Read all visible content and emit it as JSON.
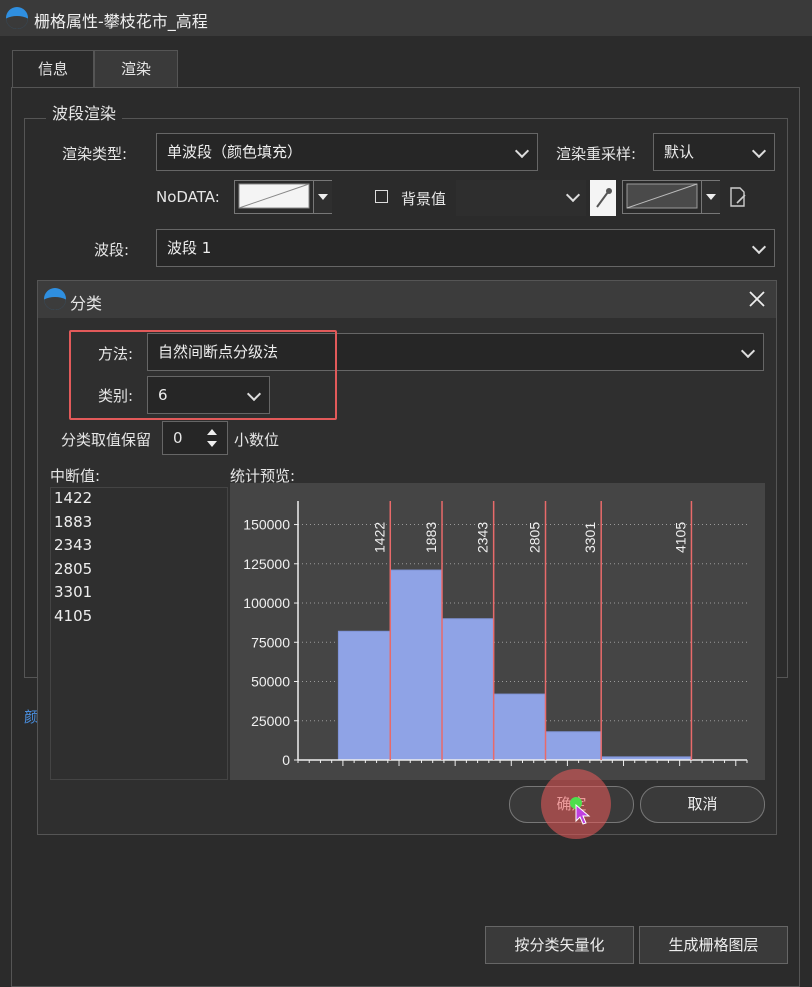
{
  "window": {
    "title": "栅格属性-攀枝花市_高程"
  },
  "tabs": [
    {
      "label": "信息"
    },
    {
      "label": "渲染"
    }
  ],
  "band_render": {
    "group_title": "波段渲染",
    "render_type_label": "渲染类型:",
    "render_type_value": "单波段（颜色填充）",
    "resample_label": "渲染重采样:",
    "resample_value": "默认",
    "nodata_label": "NoDATA:",
    "background_label": "背景值",
    "band_label": "波段:",
    "band_value": "波段 1",
    "partial_label": "颜"
  },
  "dialog": {
    "title": "分类",
    "method_label": "方法:",
    "method_value": "自然间断点分级法",
    "classes_label": "类别:",
    "classes_value": "6",
    "decimal_label": "分类取值保留",
    "decimal_value": "0",
    "decimal_suffix": "小数位",
    "breaks_label": "中断值:",
    "breaks": [
      "1422",
      "1883",
      "2343",
      "2805",
      "3301",
      "4105"
    ],
    "preview_label": "统计预览:",
    "ok_label": "确定",
    "cancel_label": "取消"
  },
  "chart_data": {
    "type": "bar",
    "title": "",
    "ylim": [
      0,
      165000
    ],
    "yticks": [
      0,
      25000,
      50000,
      75000,
      100000,
      125000,
      150000
    ],
    "bins": [
      {
        "x0": 960,
        "x1": 1422,
        "value": 82000
      },
      {
        "x0": 1422,
        "x1": 1883,
        "value": 121000
      },
      {
        "x0": 1883,
        "x1": 2343,
        "value": 90000
      },
      {
        "x0": 2343,
        "x1": 2805,
        "value": 42000
      },
      {
        "x0": 2805,
        "x1": 3301,
        "value": 18000
      },
      {
        "x0": 3301,
        "x1": 4105,
        "value": 2000
      }
    ],
    "break_lines": [
      1422,
      1883,
      2343,
      2805,
      3301,
      4105
    ],
    "break_labels": [
      "1422",
      "1883",
      "2343",
      "2805",
      "3301",
      "4105"
    ],
    "bar_color": "#8fa3e6",
    "line_color": "#e86a6a",
    "grid": true
  },
  "footer": {
    "vectorize_label": "按分类矢量化",
    "generate_label": "生成栅格图层"
  }
}
